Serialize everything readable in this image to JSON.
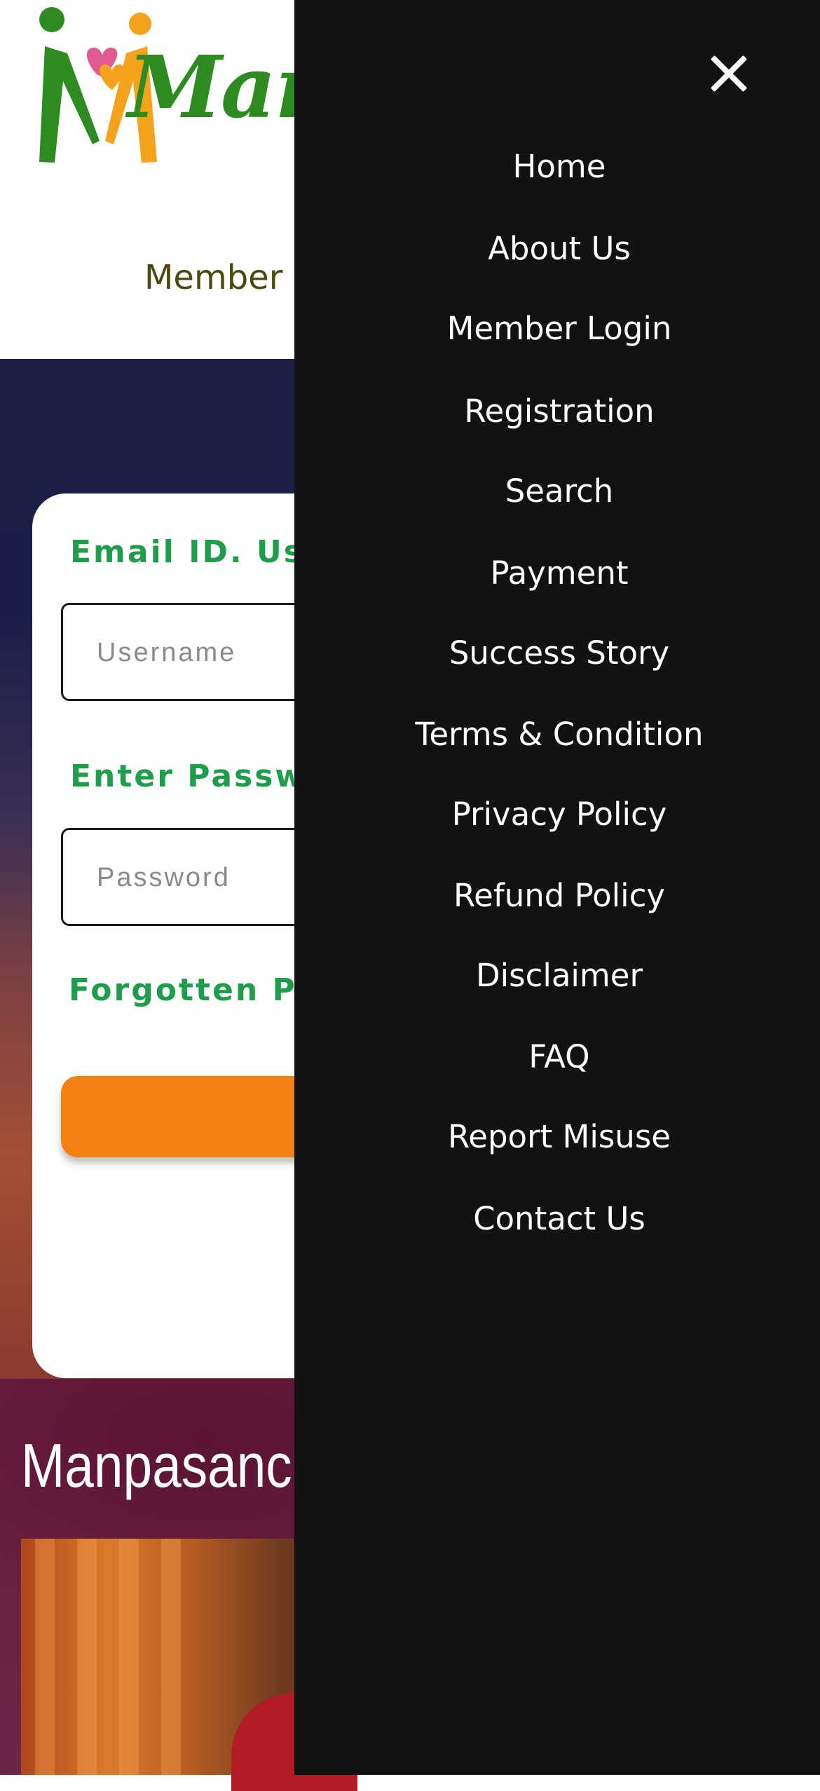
{
  "header": {
    "logo_text": "Man",
    "subtitle": "Member l"
  },
  "login_card": {
    "email_label": "Email ID. User",
    "username_placeholder": "Username",
    "password_label": "Enter Passwor",
    "password_placeholder": "Password",
    "forgot_link": "Forgotten Pas",
    "login_button_label": ""
  },
  "story": {
    "title": "Manpasanc"
  },
  "drawer": {
    "close_icon": "close-icon",
    "items": [
      "Home",
      "About Us",
      "Member Login",
      "Registration",
      "Search",
      "Payment",
      "Success Story",
      "Terms & Condition",
      "Privacy Policy",
      "Refund Policy",
      "Disclaimer",
      "FAQ",
      "Report Misuse",
      "Contact Us"
    ]
  },
  "colors": {
    "drawer_bg": "#121212",
    "label_green": "#1e9d4a",
    "button_orange": "#f18115",
    "logo_green": "#2e8b22",
    "logo_orange": "#f5a21c"
  }
}
